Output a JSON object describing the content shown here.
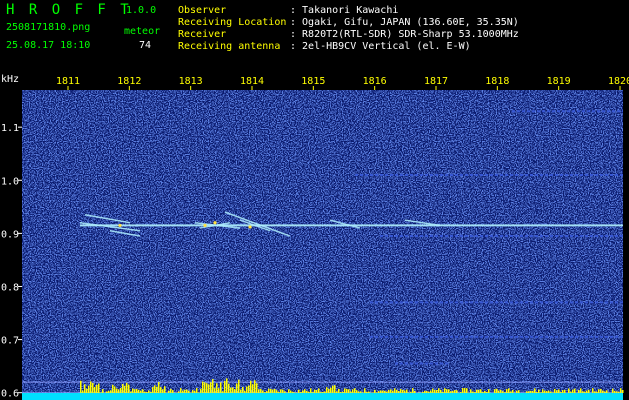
{
  "header": {
    "app_name": "H R O F F T",
    "version": "1.0.0",
    "filename": "2508171810.png",
    "meteor_label": "meteor",
    "datetime": "25.08.17 18:10",
    "meteor_count": "74",
    "fields": [
      {
        "label": "Observer",
        "value": ": Takanori Kawachi"
      },
      {
        "label": "Receiving Location",
        "value": ": Ogaki, Gifu, JAPAN (136.60E, 35.35N)"
      },
      {
        "label": "Receiver",
        "value": ": R820T2(RTL-SDR) SDR-Sharp 53.1000MHz"
      },
      {
        "label": "Receiving antenna",
        "value": ": 2el-HB9CV Vertical (el. E-W)"
      }
    ]
  },
  "chart_data": {
    "type": "heatmap",
    "ylabel": "kHz",
    "x_tick_labels": [
      "1811",
      "1812",
      "1813",
      "1814",
      "1815",
      "1816",
      "1817",
      "1818",
      "1819",
      "1820"
    ],
    "y_tick_labels": [
      "1.1",
      "1.0",
      "0.9",
      "0.8",
      "0.7",
      "0.6"
    ],
    "y_range": [
      0.59,
      1.17
    ],
    "carrier_khz": 0.915,
    "colors": {
      "background": "#0a1a6e",
      "noise": "#3a5ad8",
      "signal": "#b0f0ff",
      "meteor": "#ffe040",
      "bars": "#ffff00",
      "floor": "#00e0ff"
    }
  }
}
